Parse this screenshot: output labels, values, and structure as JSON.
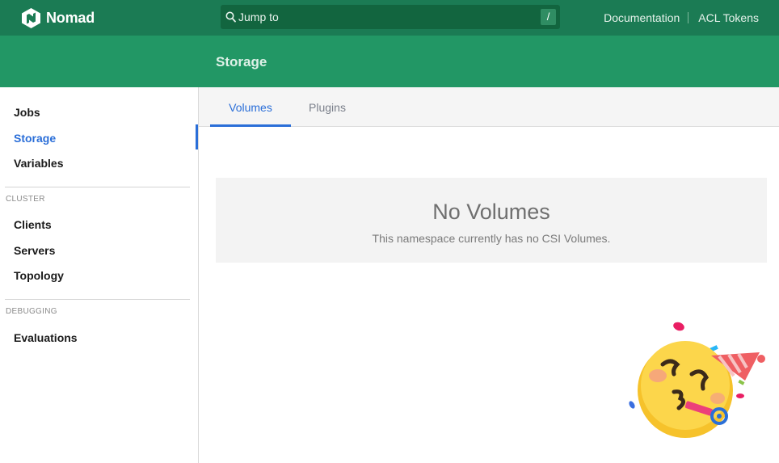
{
  "topbar": {
    "brand": "Nomad",
    "logo_icon": "nomad-logo-icon",
    "search": {
      "placeholder": "Jump to",
      "shortcut": "/",
      "icon": "search-icon"
    },
    "links": [
      "Documentation",
      "ACL Tokens"
    ]
  },
  "subheader": {
    "title": "Storage"
  },
  "sidebar": {
    "main_items": [
      {
        "label": "Jobs",
        "active": false
      },
      {
        "label": "Storage",
        "active": true
      },
      {
        "label": "Variables",
        "active": false
      }
    ],
    "cluster_heading": "CLUSTER",
    "cluster_items": [
      "Clients",
      "Servers",
      "Topology"
    ],
    "debugging_heading": "DEBUGGING",
    "debugging_items": [
      "Evaluations"
    ]
  },
  "tabs": [
    {
      "label": "Volumes",
      "active": true
    },
    {
      "label": "Plugins",
      "active": false
    }
  ],
  "empty_state": {
    "title": "No Volumes",
    "message": "This namespace currently has no CSI Volumes."
  },
  "decoration": {
    "icon": "party-face-icon"
  },
  "colors": {
    "brand_dark": "#1b7b54",
    "brand": "#229765",
    "accent_blue": "#2a6ed8"
  }
}
